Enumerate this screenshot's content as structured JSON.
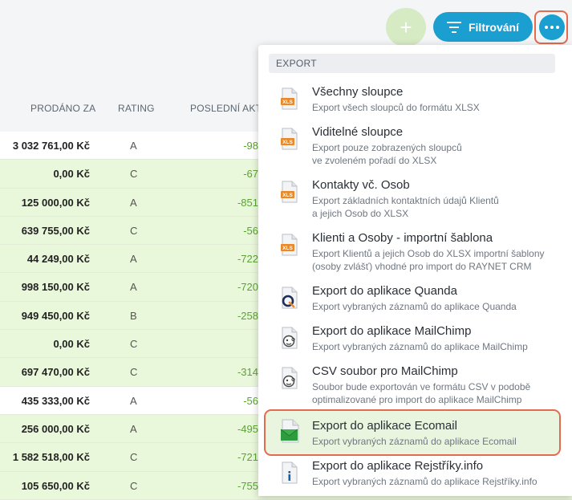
{
  "toolbar": {
    "add_symbol": "+",
    "filter_label": "Filtrování",
    "accent_color": "#1a9fd0",
    "add_color": "#d6eac4",
    "highlight_color": "#e36b4f"
  },
  "table": {
    "columns": [
      "PRODÁNO ZA",
      "RATING",
      "POSLEDNÍ AKTI"
    ],
    "rows": [
      {
        "amount": "3 032 761,00 Kč",
        "rating": "A",
        "last": "-98",
        "row_bg": "white"
      },
      {
        "amount": "0,00 Kč",
        "rating": "C",
        "last": "-67",
        "row_bg": "green"
      },
      {
        "amount": "125 000,00 Kč",
        "rating": "A",
        "last": "-851",
        "row_bg": "green"
      },
      {
        "amount": "639 755,00 Kč",
        "rating": "C",
        "last": "-56",
        "row_bg": "green"
      },
      {
        "amount": "44 249,00 Kč",
        "rating": "A",
        "last": "-722",
        "row_bg": "green"
      },
      {
        "amount": "998 150,00 Kč",
        "rating": "A",
        "last": "-720",
        "row_bg": "green"
      },
      {
        "amount": "949 450,00 Kč",
        "rating": "B",
        "last": "-258",
        "row_bg": "green"
      },
      {
        "amount": "0,00 Kč",
        "rating": "C",
        "last": "",
        "row_bg": "green"
      },
      {
        "amount": "697 470,00 Kč",
        "rating": "C",
        "last": "-314",
        "row_bg": "green"
      },
      {
        "amount": "435 333,00 Kč",
        "rating": "A",
        "last": "-56",
        "row_bg": "white"
      },
      {
        "amount": "256 000,00 Kč",
        "rating": "A",
        "last": "-495",
        "row_bg": "green"
      },
      {
        "amount": "1 582 518,00 Kč",
        "rating": "C",
        "last": "-721",
        "row_bg": "green"
      },
      {
        "amount": "105 650,00 Kč",
        "rating": "C",
        "last": "-755",
        "row_bg": "green"
      }
    ]
  },
  "dropdown": {
    "section": "EXPORT",
    "items": [
      {
        "title": "Všechny sloupce",
        "desc": [
          "Export všech sloupců do formátu XLSX"
        ],
        "icon": "xls-file-icon"
      },
      {
        "title": "Viditelné sloupce",
        "desc": [
          "Export pouze zobrazených sloupců",
          "ve zvoleném pořadí do XLSX"
        ],
        "icon": "xls-file-icon"
      },
      {
        "title": "Kontakty vč. Osob",
        "desc": [
          "Export základních kontaktních údajů Klientů",
          "a jejich Osob do XLSX"
        ],
        "icon": "xls-file-icon"
      },
      {
        "title": "Klienti a Osoby - importní šablona",
        "desc": [
          "Export Klientů a jejich Osob do XLSX importní šablony",
          "(osoby zvlášť) vhodné pro import do RAYNET CRM"
        ],
        "icon": "xls-file-icon"
      },
      {
        "title": "Export do aplikace Quanda",
        "desc": [
          "Export vybraných záznamů do aplikace Quanda"
        ],
        "icon": "quanda-icon"
      },
      {
        "title": "Export do aplikace MailChimp",
        "desc": [
          "Export vybraných záznamů do aplikace MailChimp"
        ],
        "icon": "mailchimp-icon"
      },
      {
        "title": "CSV soubor pro MailChimp",
        "desc": [
          "Soubor bude exportován ve formátu CSV v podobě",
          "optimalizované pro import do aplikace MailChimp"
        ],
        "icon": "mailchimp-icon"
      },
      {
        "title": "Export do aplikace Ecomail",
        "desc": [
          "Export vybraných záznamů do aplikace Ecomail"
        ],
        "icon": "ecomail-icon",
        "selected": true
      },
      {
        "title": "Export do aplikace Rejstříky.info",
        "desc": [
          "Export vybraných záznamů do aplikace Rejstříky.info"
        ],
        "icon": "rejstriky-icon"
      }
    ],
    "xls_badge": "XLS"
  }
}
